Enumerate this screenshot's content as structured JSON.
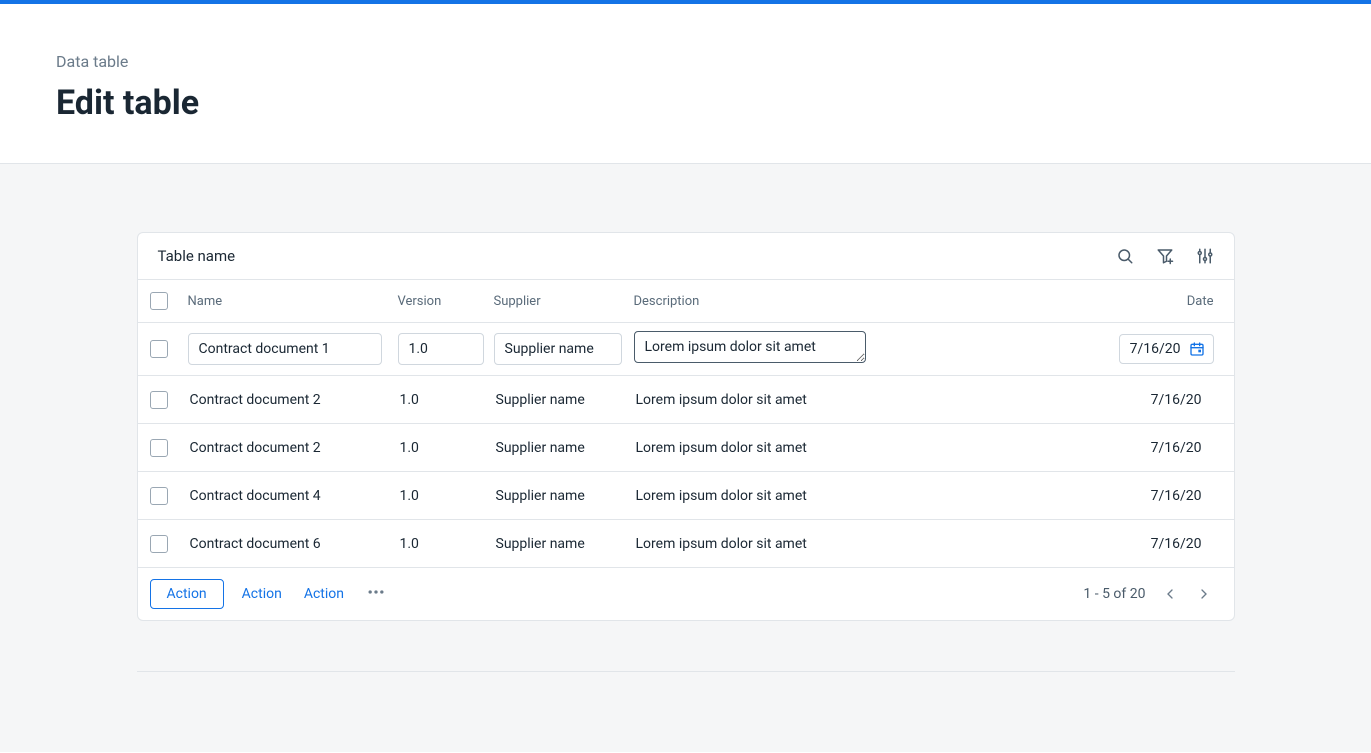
{
  "brand_accent": "#1473e6",
  "breadcrumb": "Data table",
  "page_title": "Edit table",
  "table": {
    "title": "Table name",
    "columns": {
      "name": "Name",
      "version": "Version",
      "supplier": "Supplier",
      "description": "Description",
      "date": "Date"
    },
    "rows": [
      {
        "name": "Contract document 1",
        "version": "1.0",
        "supplier": "Supplier name",
        "description": "Lorem ipsum dolor sit amet",
        "date": "7/16/20",
        "editing": true
      },
      {
        "name": "Contract document 2",
        "version": "1.0",
        "supplier": "Supplier name",
        "description": "Lorem ipsum dolor sit amet",
        "date": "7/16/20",
        "editing": false
      },
      {
        "name": "Contract document 2",
        "version": "1.0",
        "supplier": "Supplier name",
        "description": "Lorem ipsum dolor sit amet",
        "date": "7/16/20",
        "editing": false
      },
      {
        "name": "Contract document 4",
        "version": "1.0",
        "supplier": "Supplier name",
        "description": "Lorem ipsum dolor sit amet",
        "date": "7/16/20",
        "editing": false
      },
      {
        "name": "Contract document 6",
        "version": "1.0",
        "supplier": "Supplier name",
        "description": "Lorem ipsum dolor sit amet",
        "date": "7/16/20",
        "editing": false
      }
    ]
  },
  "footer": {
    "action_primary": "Action",
    "action_link_1": "Action",
    "action_link_2": "Action",
    "pagination": "1 - 5 of 20"
  },
  "icons": {
    "search": "search-icon",
    "filter": "filter-add-icon",
    "settings": "sliders-icon",
    "calendar": "calendar-icon",
    "more": "more-horizontal-icon",
    "prev": "chevron-left-icon",
    "next": "chevron-right-icon"
  }
}
